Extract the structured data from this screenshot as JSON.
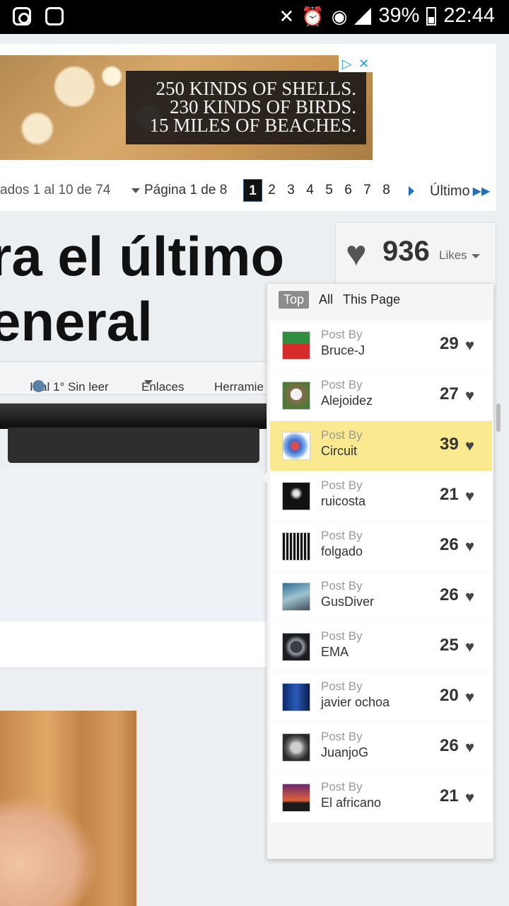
{
  "status": {
    "battery": "39%",
    "time": "22:44"
  },
  "ad": {
    "lines": [
      "250 KINDS OF SHELLS.",
      "230 KINDS OF BIRDS.",
      "15 MILES OF BEACHES."
    ]
  },
  "pager": {
    "results": "ados 1 al 10 de 74",
    "page_label": "Página 1 de 8",
    "pages": [
      "1",
      "2",
      "3",
      "4",
      "5",
      "6",
      "7",
      "8"
    ],
    "last": "Último"
  },
  "title": {
    "line1": "ra el último",
    "line2": "eneral"
  },
  "toolbar": {
    "first_unread": "Ir al 1° Sin leer",
    "links": "Enlaces",
    "tools": "Herramie"
  },
  "likes": {
    "count": "936",
    "label": "Likes"
  },
  "tabs": [
    "Top",
    "All",
    "This Page"
  ],
  "entries": [
    {
      "prefix": "Post By",
      "name": "Bruce-J",
      "score": "29",
      "highlight": false
    },
    {
      "prefix": "Post By",
      "name": "Alejoidez",
      "score": "27",
      "highlight": false
    },
    {
      "prefix": "Post By",
      "name": "Circuit",
      "score": "39",
      "highlight": true
    },
    {
      "prefix": "Post By",
      "name": "ruicosta",
      "score": "21",
      "highlight": false
    },
    {
      "prefix": "Post By",
      "name": "folgado",
      "score": "26",
      "highlight": false
    },
    {
      "prefix": "Post By",
      "name": "GusDiver",
      "score": "26",
      "highlight": false
    },
    {
      "prefix": "Post By",
      "name": "EMA",
      "score": "25",
      "highlight": false
    },
    {
      "prefix": "Post By",
      "name": "javier ochoa",
      "score": "20",
      "highlight": false
    },
    {
      "prefix": "Post By",
      "name": "JuanjoG",
      "score": "26",
      "highlight": false
    },
    {
      "prefix": "Post By",
      "name": "El africano",
      "score": "21",
      "highlight": false
    }
  ],
  "colors": {
    "highlight": "#fbe98f",
    "accent": "#1e73be"
  }
}
